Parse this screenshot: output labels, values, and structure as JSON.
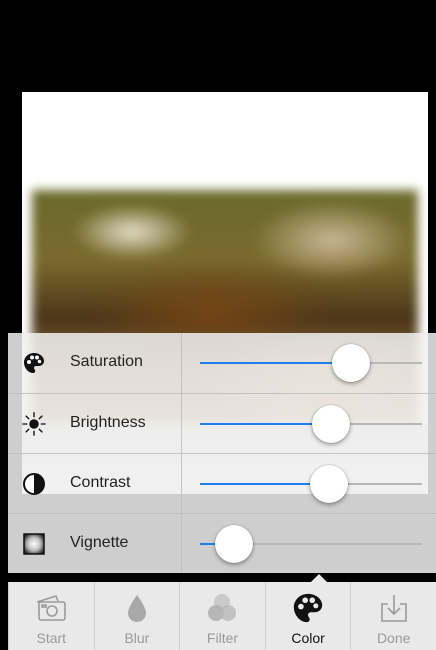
{
  "colors": {
    "accent": "#1e7ef0",
    "track": "#b8b8b8",
    "tab_inactive": "#9a9a9a",
    "tab_active": "#111111"
  },
  "adjustments": [
    {
      "label": "Saturation",
      "icon": "palette-icon",
      "value": 0.72
    },
    {
      "label": "Brightness",
      "icon": "sun-icon",
      "value": 0.61
    },
    {
      "label": "Contrast",
      "icon": "contrast-icon",
      "value": 0.6
    },
    {
      "label": "Vignette",
      "icon": "vignette-icon",
      "value": 0.08
    }
  ],
  "tabs": [
    {
      "label": "Start",
      "icon": "camera-icon",
      "active": false
    },
    {
      "label": "Blur",
      "icon": "drop-icon",
      "active": false
    },
    {
      "label": "Filter",
      "icon": "filter-circles-icon",
      "active": false
    },
    {
      "label": "Color",
      "icon": "palette-icon",
      "active": true
    },
    {
      "label": "Done",
      "icon": "download-icon",
      "active": false
    }
  ]
}
